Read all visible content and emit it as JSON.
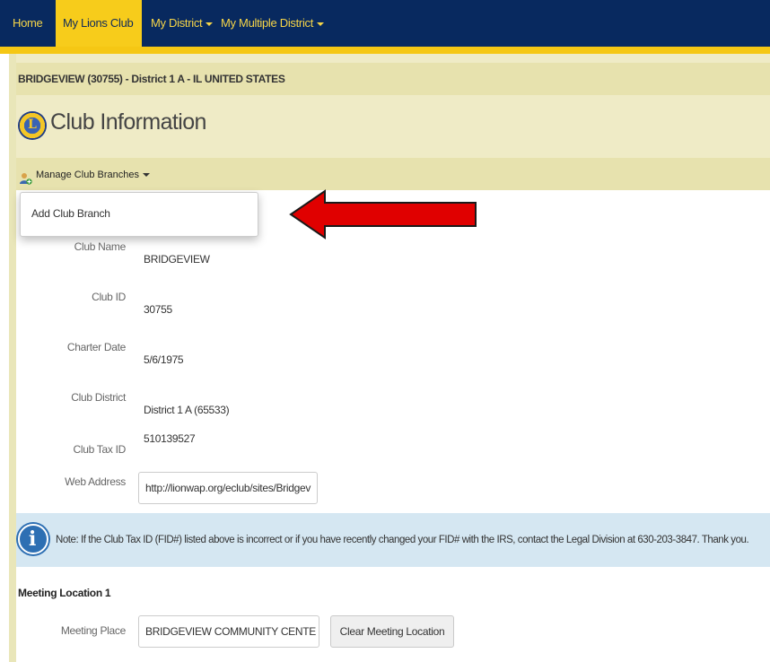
{
  "nav": {
    "home": "Home",
    "my_lions_club": "My Lions Club",
    "my_district": "My District",
    "my_multiple_district": "My Multiple District"
  },
  "breadcrumb": "BRIDGEVIEW (30755) - District 1 A - IL UNITED STATES",
  "page_title": "Club Information",
  "toolbar": {
    "manage_label": "Manage Club Branches"
  },
  "dropdown": {
    "items": [
      "Add Club Branch"
    ]
  },
  "form": {
    "club_name": {
      "label": "Club Name",
      "value": "BRIDGEVIEW"
    },
    "club_id": {
      "label": "Club ID",
      "value": "30755"
    },
    "charter_date": {
      "label": "Charter Date",
      "value": "5/6/1975"
    },
    "club_district": {
      "label": "Club District",
      "value": "District 1 A (65533)"
    },
    "club_tax_id": {
      "label": "Club Tax ID",
      "value": "510139527"
    },
    "web_address": {
      "label": "Web Address",
      "value": "http://lionwap.org/eclub/sites/Bridgev"
    }
  },
  "note": "Note: If the Club Tax ID (FID#) listed above is incorrect or if you have recently changed your FID# with the IRS, contact the Legal Division at 630-203-3847. Thank you.",
  "meeting": {
    "section_title": "Meeting Location 1",
    "place_label": "Meeting Place",
    "place_value": "BRIDGEVIEW COMMUNITY CENTE",
    "clear_label": "Clear Meeting Location"
  },
  "colors": {
    "nav_bg": "#08295f",
    "nav_text": "#f6d548",
    "active_tab": "#f7cc1b",
    "header_band": "#efebc6",
    "note_band": "#d5e7f2",
    "arrow": "#e00000"
  }
}
